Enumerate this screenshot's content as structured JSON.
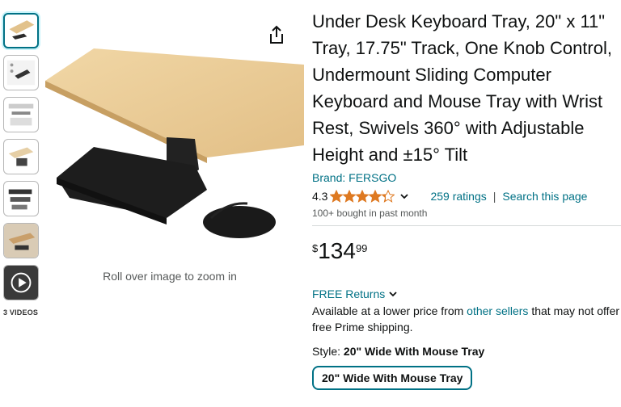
{
  "thumbnails": [
    {
      "name": "thumbnail-1",
      "active": true
    },
    {
      "name": "thumbnail-2",
      "active": false
    },
    {
      "name": "thumbnail-3",
      "active": false
    },
    {
      "name": "thumbnail-4",
      "active": false
    },
    {
      "name": "thumbnail-5",
      "active": false
    },
    {
      "name": "thumbnail-6",
      "active": false
    },
    {
      "name": "thumbnail-video",
      "active": false
    }
  ],
  "videos_label": "3 VIDEOS",
  "zoom_hint": "Roll over image to zoom in",
  "share_icon": "share-icon",
  "product": {
    "title": "Under Desk Keyboard Tray, 20\" x 11\" Tray, 17.75\" Track, One Knob Control, Undermount Sliding Computer Keyboard and Mouse Tray with Wrist Rest, Swivels 360° with Adjustable Height and ±15° Tilt",
    "brand": "Brand: FERSGO",
    "rating": "4.3",
    "rating_value": 4.3,
    "ratings_count": "259 ratings",
    "separator": "|",
    "search_page": "Search this page",
    "bought": "100+ bought in past month",
    "price_symbol": "$",
    "price_whole": "134",
    "price_fraction": "99",
    "returns": "FREE Returns",
    "availability_pre": "Available at a lower price from ",
    "availability_link": "other sellers",
    "availability_post": " that may not offer free Prime shipping.",
    "style_label": "Style: ",
    "style_value": "20\" Wide With Mouse Tray",
    "style_button": "20\" Wide With Mouse Tray"
  },
  "colors": {
    "link": "#007185",
    "star": "#de7921",
    "text": "#0f1111",
    "muted": "#565959"
  }
}
